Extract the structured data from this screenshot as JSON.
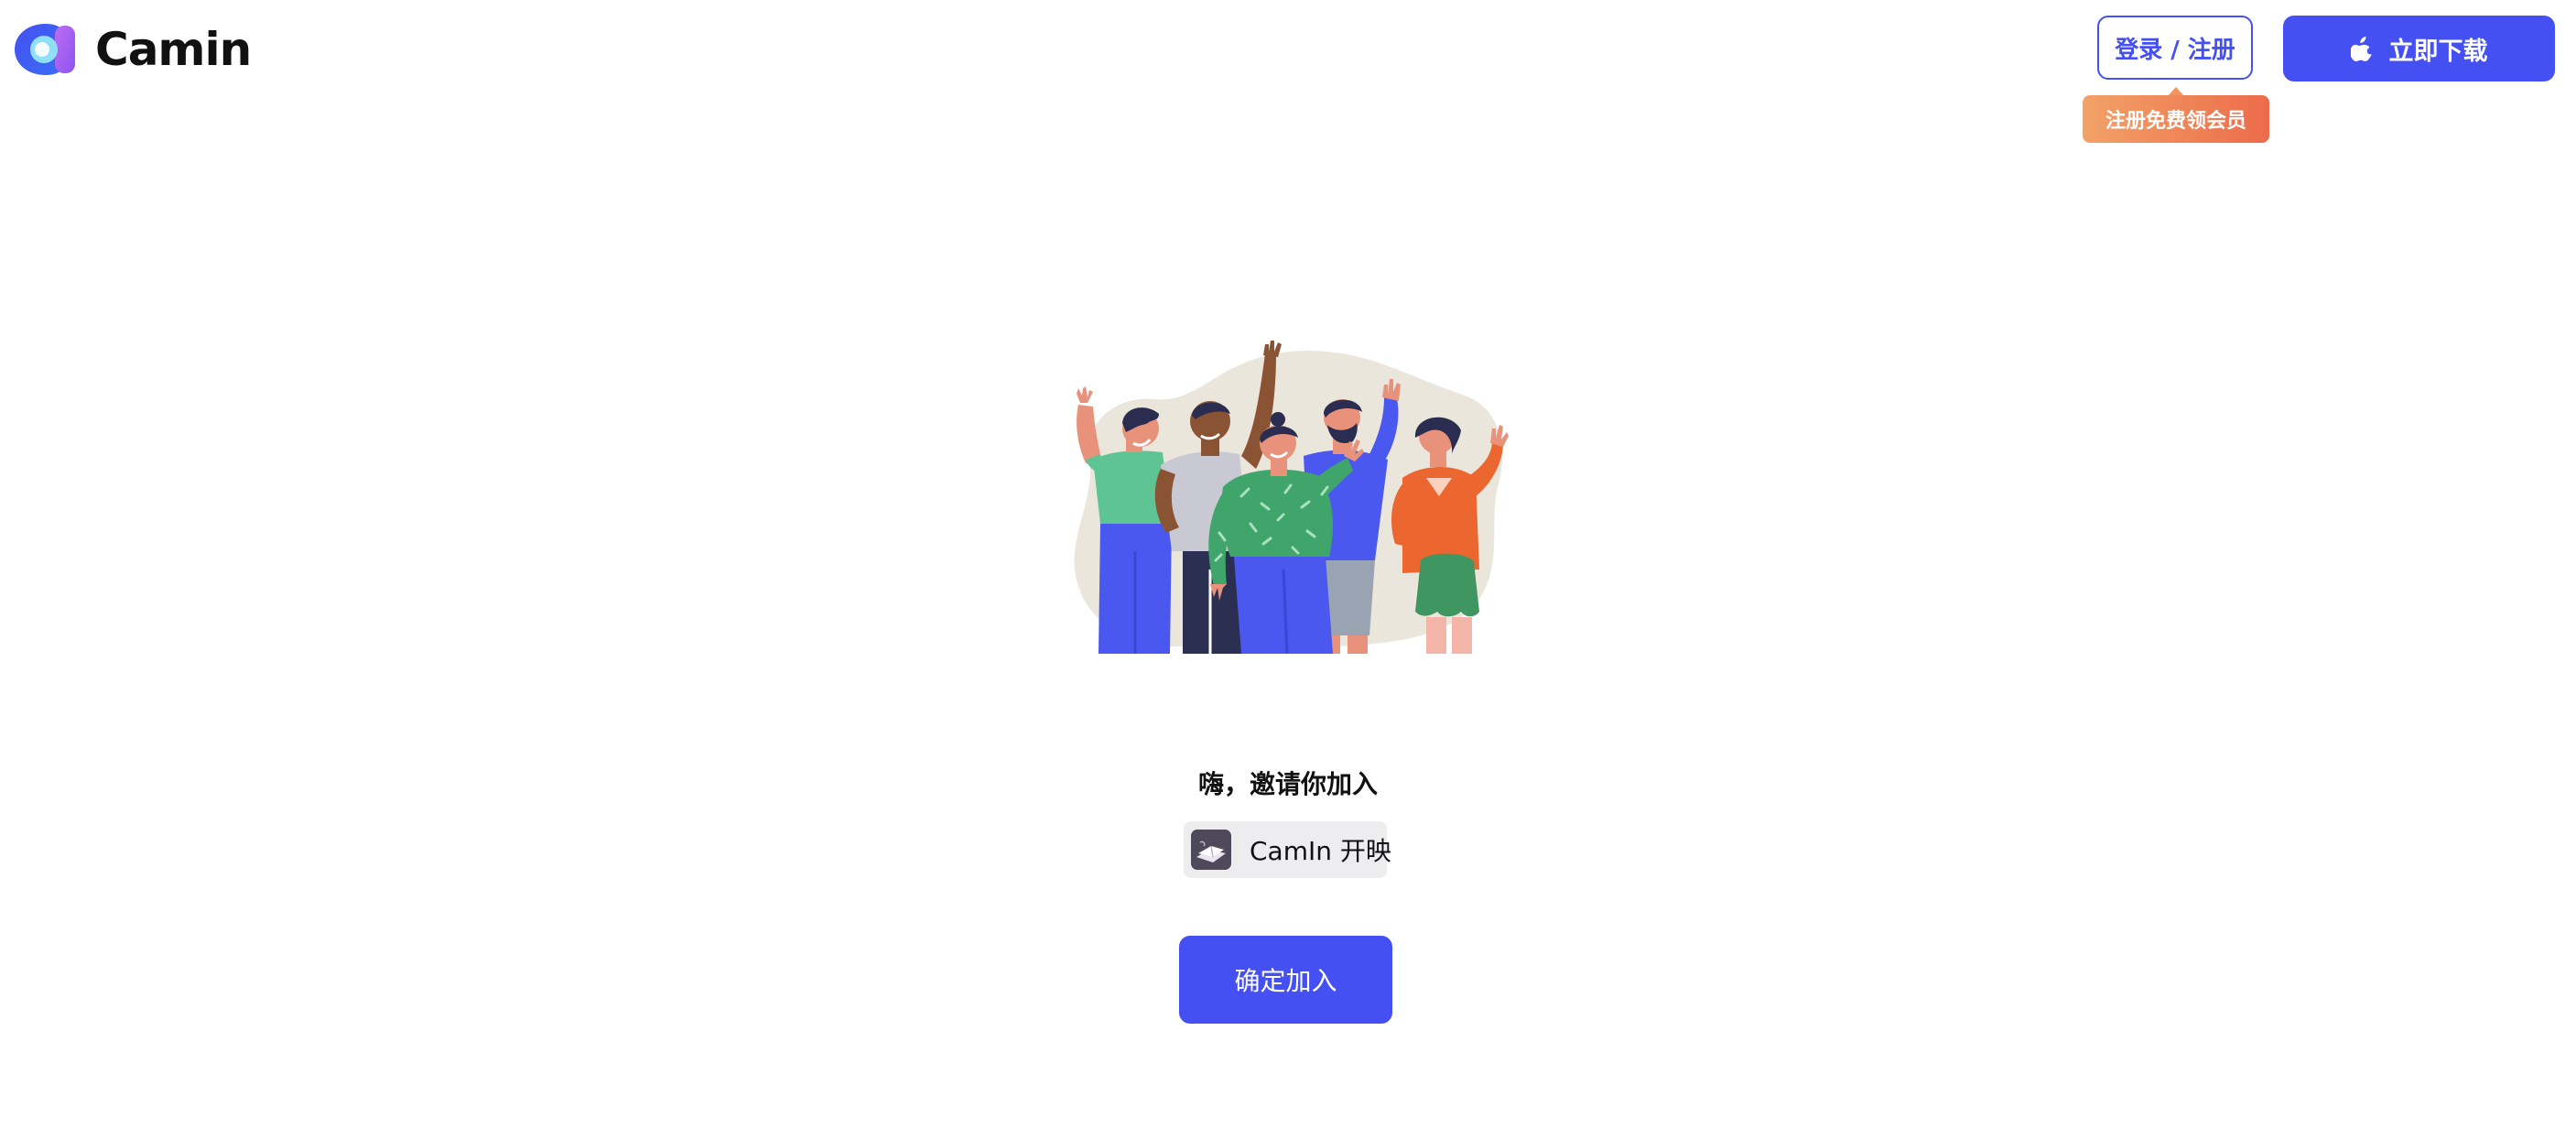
{
  "brand": {
    "name": "Camin",
    "logo_colors": [
      "#4450f2",
      "#b45cf0",
      "#6cc8f5"
    ]
  },
  "header": {
    "login_label": "登录 / 注册",
    "download_label": "立即下载",
    "promo_tip": "注册免费领会员"
  },
  "main": {
    "invite_title": "嗨，邀请你加入",
    "team_name": "CamIn 开映",
    "confirm_label": "确定加入"
  },
  "colors": {
    "accent": "#4450f2",
    "promo_start": "#f3a268",
    "promo_end": "#ec6b4a",
    "chip_bg": "#ededf0"
  }
}
